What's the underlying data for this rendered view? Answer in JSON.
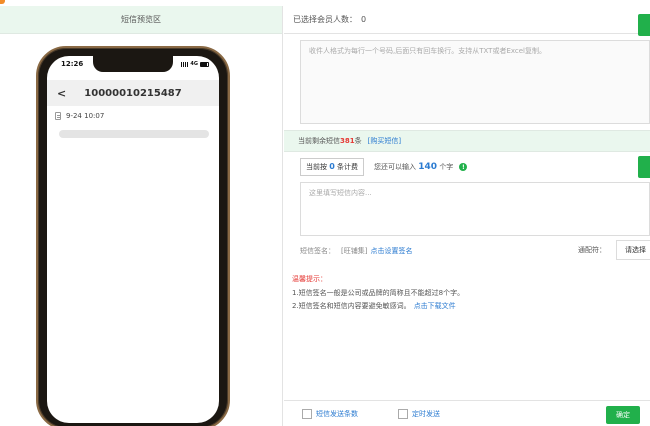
{
  "left_panel": {
    "header": "短信预览区",
    "phone": {
      "status_time": "12:26",
      "network": "4G",
      "nav_title": "10000010215487",
      "back_symbol": "<",
      "message_time": "9-24  10:07"
    }
  },
  "right_panel": {
    "selected_members_label": "已选择会员人数：",
    "selected_members_count": "0",
    "recipients_placeholder": "收件人格式为每行一个号码,后面只有回车换行。支持从TXT或者Excel复制。",
    "remaining": {
      "prefix": "当前剩余短信",
      "count": "381",
      "suffix": "条",
      "buy_link": "[购买短信]"
    },
    "counter": {
      "prefix": "当前按",
      "count": "0",
      "suffix": "条计费",
      "chars_prefix": "您还可以输入",
      "chars_count": "140",
      "chars_suffix": "个字",
      "info_icon": "!"
    },
    "content_placeholder": "这里填写短信内容...",
    "signature": {
      "label": "短信签名：",
      "value": "[旺铺集]",
      "set_link": "点击设置签名"
    },
    "wildcard": {
      "label": "通配符：",
      "select": "请选择"
    },
    "tips": {
      "title": "温馨提示：",
      "line1": "1.短信签名一般是公司或品牌的简称且不能超过8个字。",
      "line2": "2.短信签名和短信内容要避免敏感词。",
      "line2_link": "点击下载文件"
    },
    "bottom": {
      "option1": "短信发送条数",
      "option2": "定时发送",
      "confirm": "确定"
    }
  },
  "colors": {
    "accent_green": "#21b04b",
    "link_blue": "#2b7bd1",
    "warning_red": "#e53935",
    "header_green_bg": "#eaf7ee"
  }
}
